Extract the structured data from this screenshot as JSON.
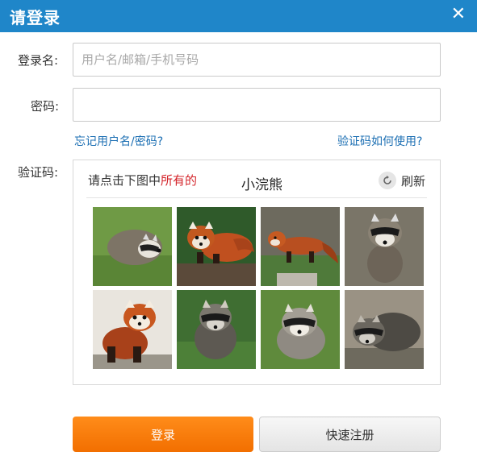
{
  "dialog": {
    "title": "请登录",
    "close_icon": "close-icon"
  },
  "form": {
    "username_label": "登录名:",
    "username_placeholder": "用户名/邮箱/手机号码",
    "username_value": "",
    "password_label": "密码:",
    "password_value": "",
    "forgot_link": "忘记用户名/密码?",
    "captcha_help_link": "验证码如何使用?",
    "captcha_label": "验证码:"
  },
  "captcha": {
    "instruction_prefix": "请点击下图中",
    "instruction_highlight": "所有的",
    "keyword": "小浣熊",
    "refresh_label": "刷新",
    "refresh_icon": "refresh-icon",
    "highlight_color": "#d4242a",
    "images": [
      {
        "animal": "raccoon"
      },
      {
        "animal": "red-panda"
      },
      {
        "animal": "red-panda"
      },
      {
        "animal": "raccoon"
      },
      {
        "animal": "red-panda"
      },
      {
        "animal": "raccoon"
      },
      {
        "animal": "raccoon"
      },
      {
        "animal": "raccoon"
      }
    ]
  },
  "buttons": {
    "login_label": "登录",
    "register_label": "快速注册"
  },
  "colors": {
    "titlebar": "#1f86c9",
    "link": "#1c6fb3",
    "login_button": "#f47a0a"
  }
}
